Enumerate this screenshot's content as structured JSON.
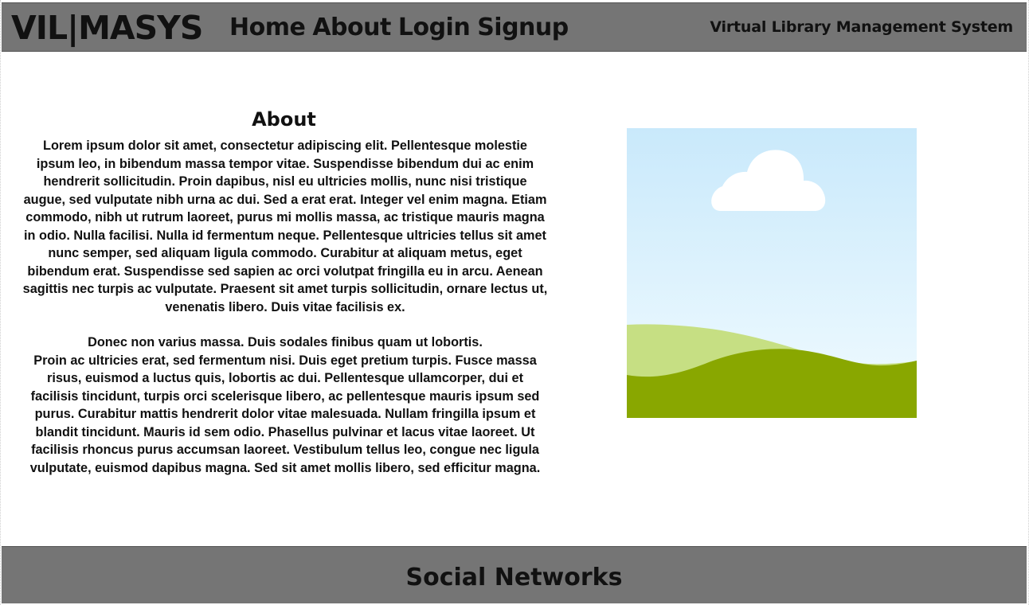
{
  "header": {
    "logo": "VIL|MASYS",
    "nav": {
      "home": "Home",
      "about": "About",
      "login": "Login",
      "signup": "Signup"
    },
    "subtitle": "Virtual Library Management System"
  },
  "main": {
    "title": "About",
    "paragraphs": [
      "Lorem ipsum dolor sit amet, consectetur adipiscing elit. Pellentesque molestie ipsum leo, in bibendum massa tempor vitae. Suspendisse bibendum dui ac enim hendrerit sollicitudin. Proin dapibus, nisl eu ultricies mollis, nunc nisi tristique augue, sed vulputate nibh urna ac dui. Sed a erat erat. Integer vel enim magna. Etiam commodo, nibh ut rutrum laoreet, purus mi mollis massa, ac tristique mauris magna in odio. Nulla facilisi. Nulla id fermentum neque. Pellentesque ultricies tellus sit amet nunc semper, sed aliquam ligula commodo. Curabitur at aliquam metus, eget bibendum erat. Suspendisse sed sapien ac orci volutpat fringilla eu in arcu. Aenean sagittis nec turpis ac vulputate. Praesent sit amet turpis sollicitudin, ornare lectus ut, venenatis libero. Duis vitae facilisis ex.",
      "Donec non varius massa. Duis sodales finibus quam ut lobortis.",
      "Proin ac ultricies erat, sed fermentum nisi. Duis eget pretium turpis. Fusce massa risus, euismod a luctus quis, lobortis ac dui. Pellentesque ullamcorper, dui et facilisis tincidunt, turpis orci scelerisque libero, ac pellentesque mauris ipsum sed purus. Curabitur mattis hendrerit dolor vitae malesuada. Nullam fringilla ipsum et blandit tincidunt. Mauris id sem odio. Phasellus pulvinar et lacus vitae laoreet. Ut facilisis rhoncus purus accumsan laoreet. Vestibulum tellus leo, congue nec ligula vulputate, euismod dapibus magna. Sed sit amet mollis libero, sed efficitur magna."
    ],
    "image": {
      "icon": "landscape-placeholder-icon",
      "sky_top": "#c9e9fb",
      "sky_bottom": "#f1fbff",
      "cloud": "#ffffff",
      "hill_light": "#c6df83",
      "hill_dark": "#89a700"
    }
  },
  "footer": {
    "title": "Social Networks"
  },
  "colors": {
    "bar_background": "#757575",
    "text": "#111111",
    "page_background": "#ffffff"
  }
}
